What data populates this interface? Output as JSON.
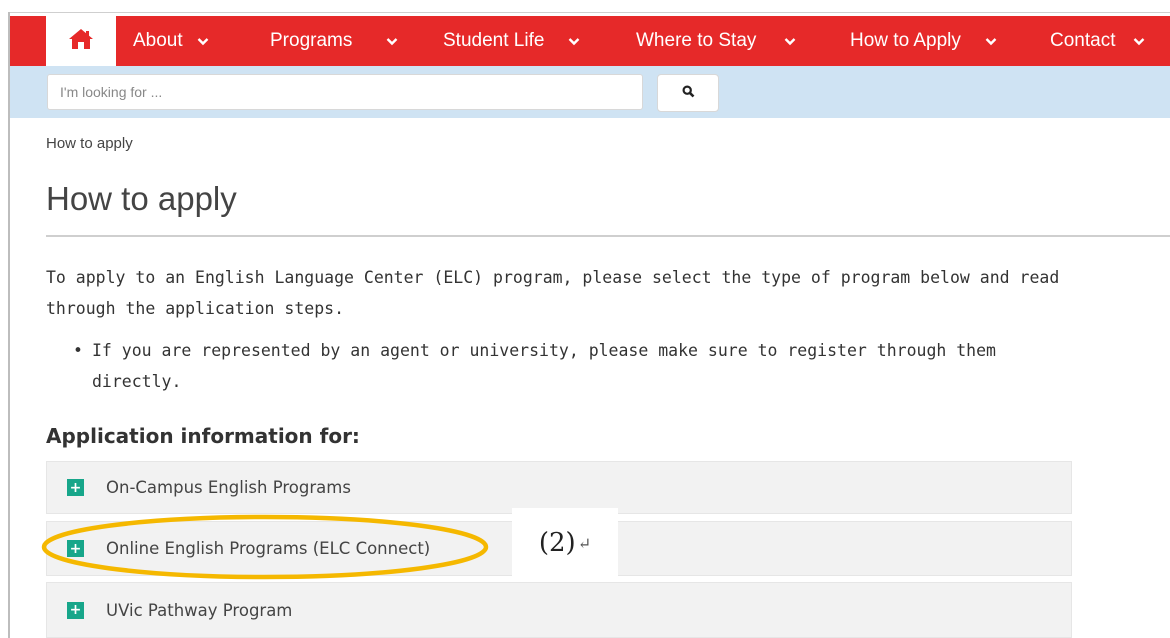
{
  "nav": {
    "items": [
      {
        "label": "About"
      },
      {
        "label": "Programs"
      },
      {
        "label": "Student Life"
      },
      {
        "label": "Where to Stay"
      },
      {
        "label": "How to Apply"
      },
      {
        "label": "Contact"
      }
    ],
    "home_icon": "home-icon",
    "chevron_icon": "chevron-down-icon"
  },
  "search": {
    "placeholder": "I'm looking for ...",
    "button_icon": "search-icon"
  },
  "breadcrumb": "How to apply",
  "page_title": "How to apply",
  "intro": "To apply to an English Language Center (ELC) program, please select the type of program below and read through the application steps.",
  "bullets": [
    "If you are represented by an agent or university, please make sure to register through them directly."
  ],
  "application_heading": "Application information for:",
  "accordion": [
    {
      "label": "On-Campus English Programs",
      "icon": "plus-icon"
    },
    {
      "label": "Online English Programs (ELC Connect)",
      "icon": "plus-icon"
    },
    {
      "label": "UVic Pathway Program",
      "icon": "plus-icon"
    }
  ],
  "annotation": {
    "label": "(2)",
    "return_mark": "↵"
  },
  "colors": {
    "nav_bg": "#e62929",
    "search_bar_bg": "#cfe3f3",
    "accordion_icon": "#17a68a",
    "highlight": "#f5b800"
  }
}
